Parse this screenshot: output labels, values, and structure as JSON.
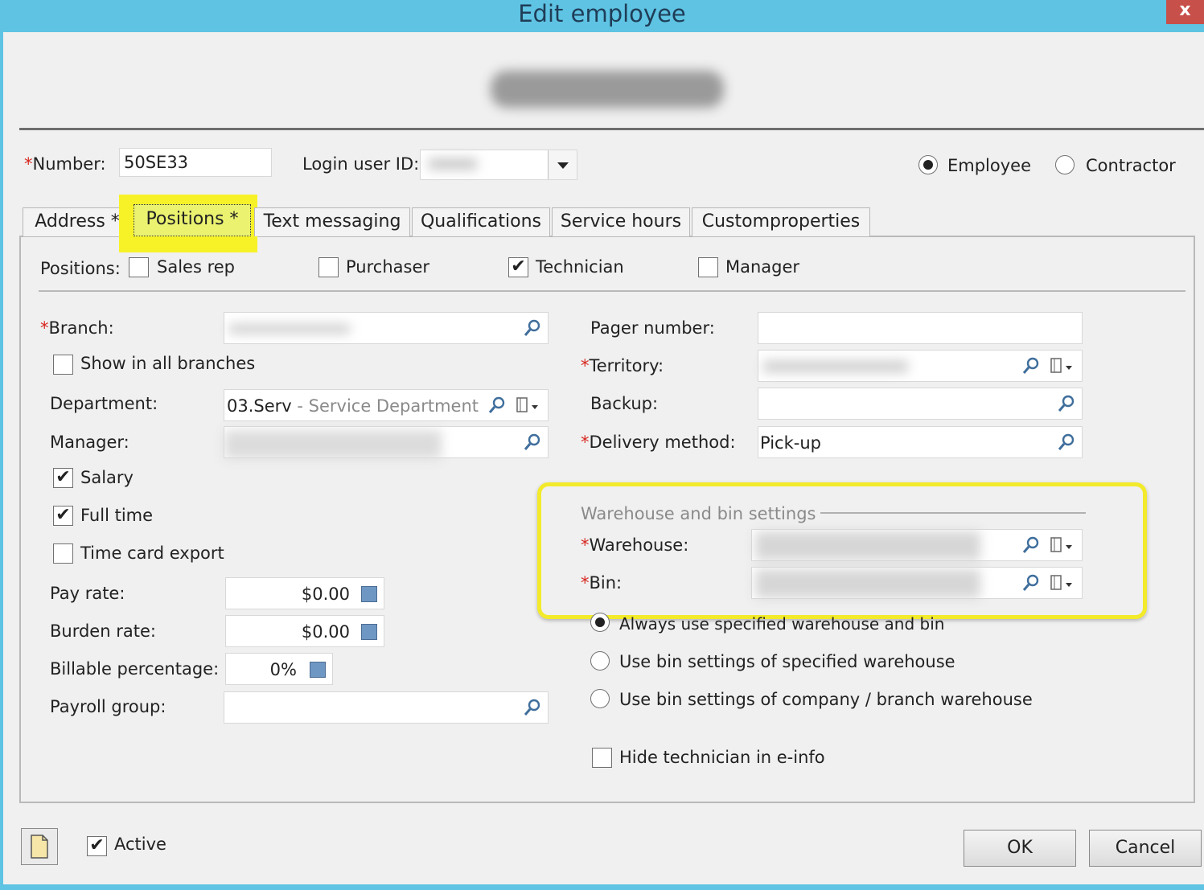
{
  "window": {
    "title": "Edit employee",
    "close_label": "x"
  },
  "header": {
    "number_label": "Number:",
    "number_value": "50SE33",
    "login_label": "Login user ID:",
    "login_value": "",
    "employee_label": "Employee",
    "contractor_label": "Contractor",
    "type_selected": "Employee"
  },
  "tabs": [
    {
      "label": "Address *"
    },
    {
      "label": "Positions *",
      "active": true
    },
    {
      "label": "Text messaging"
    },
    {
      "label": "Qualifications"
    },
    {
      "label": "Service hours"
    },
    {
      "label": "Customproperties"
    }
  ],
  "positions": {
    "label": "Positions:",
    "items": [
      {
        "label": "Sales rep",
        "checked": false
      },
      {
        "label": "Purchaser",
        "checked": false
      },
      {
        "label": "Technician",
        "checked": true
      },
      {
        "label": "Manager",
        "checked": false
      }
    ]
  },
  "left": {
    "branch_label": "Branch:",
    "show_all_branches": "Show in all branches",
    "department_label": "Department:",
    "department_code": "03.Serv",
    "department_name": " - Service Department",
    "manager_label": "Manager:",
    "salary_label": "Salary",
    "fulltime_label": "Full time",
    "timecard_label": "Time card export",
    "payrate_label": "Pay rate:",
    "payrate_value": "$0.00",
    "burden_label": "Burden rate:",
    "burden_value": "$0.00",
    "billable_label": "Billable percentage:",
    "billable_value": "0%",
    "payroll_label": "Payroll group:"
  },
  "right": {
    "pager_label": "Pager number:",
    "territory_label": "Territory:",
    "backup_label": "Backup:",
    "delivery_label": "Delivery method:",
    "delivery_value": "Pick-up",
    "wh_group_label": "Warehouse and bin settings",
    "warehouse_label": "Warehouse:",
    "bin_label": "Bin:",
    "radio_always": "Always use specified warehouse and bin",
    "radio_specified": "Use bin settings of specified warehouse",
    "radio_company": "Use bin settings of company / branch warehouse",
    "hide_tech_label": "Hide technician in e-info"
  },
  "footer": {
    "active_label": "Active",
    "ok_label": "OK",
    "cancel_label": "Cancel"
  },
  "colors": {
    "highlight_yellow": "#f7f227",
    "title_bar": "#5fc3e3",
    "required": "#d7261e"
  }
}
